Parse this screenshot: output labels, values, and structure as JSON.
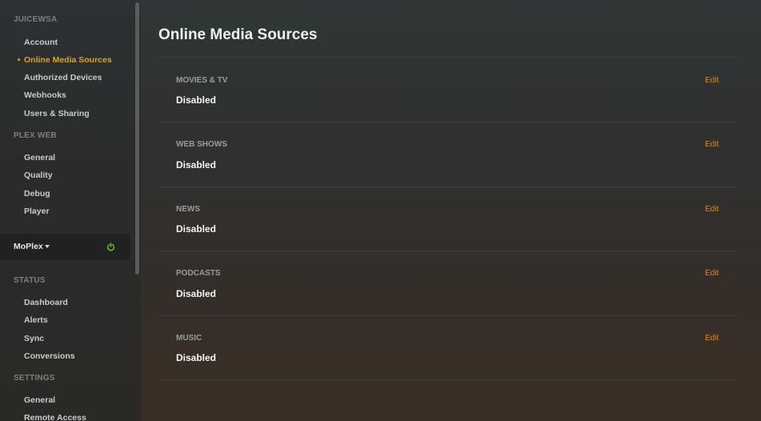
{
  "sidebar": {
    "sections": [
      {
        "heading": "JUICEWSA",
        "items": [
          "Account",
          "Online Media Sources",
          "Authorized Devices",
          "Webhooks",
          "Users & Sharing"
        ]
      },
      {
        "heading": "PLEX WEB",
        "items": [
          "General",
          "Quality",
          "Debug",
          "Player"
        ]
      },
      {
        "heading": "STATUS",
        "items": [
          "Dashboard",
          "Alerts",
          "Sync",
          "Conversions"
        ]
      },
      {
        "heading": "SETTINGS",
        "items": [
          "General",
          "Remote Access"
        ]
      }
    ],
    "active_item": "Online Media Sources",
    "server": {
      "name": "MoPlex",
      "status_color": "#6fbf3c"
    }
  },
  "main": {
    "title": "Online Media Sources",
    "sources": [
      {
        "label": "MOVIES & TV",
        "value": "Disabled",
        "action": "Edit"
      },
      {
        "label": "WEB SHOWS",
        "value": "Disabled",
        "action": "Edit"
      },
      {
        "label": "NEWS",
        "value": "Disabled",
        "action": "Edit"
      },
      {
        "label": "PODCASTS",
        "value": "Disabled",
        "action": "Edit"
      },
      {
        "label": "MUSIC",
        "value": "Disabled",
        "action": "Edit"
      }
    ]
  },
  "colors": {
    "accent": "#e5a00d",
    "edit": "#d58a2f"
  }
}
